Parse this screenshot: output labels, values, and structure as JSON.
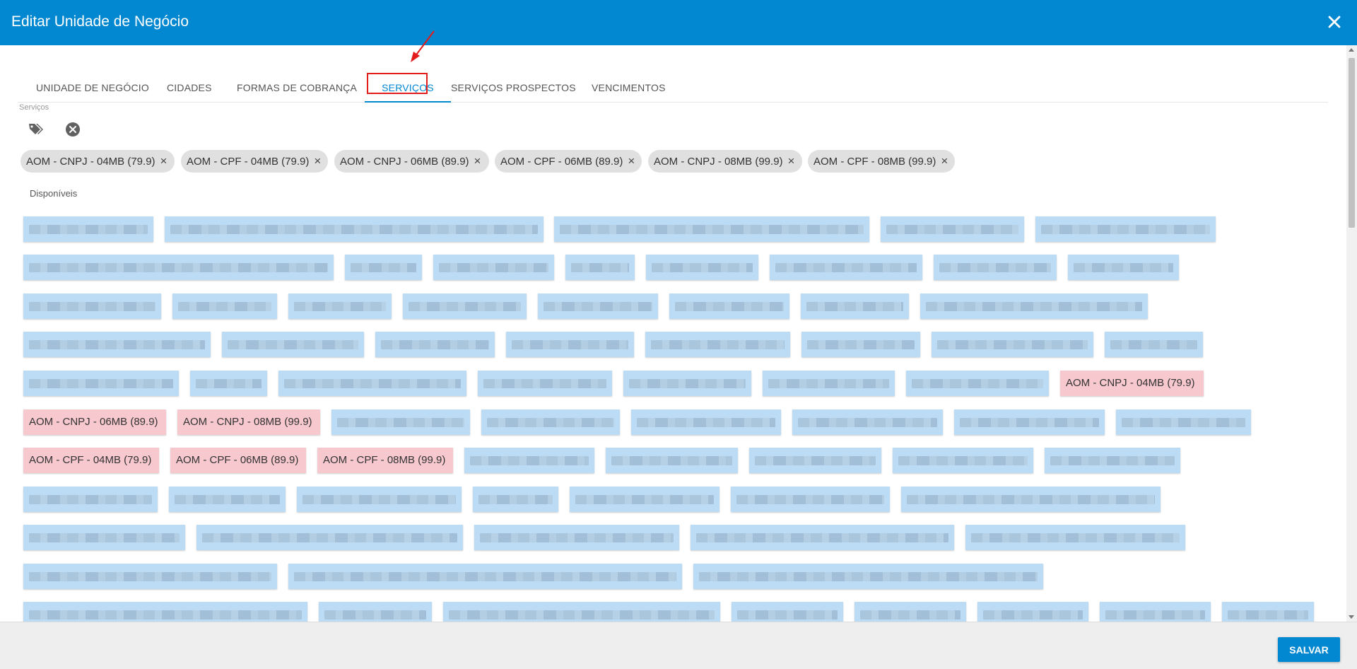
{
  "dialog": {
    "title": "Editar Unidade de Negócio",
    "close_icon": "close-icon"
  },
  "tabs": [
    {
      "label": "Unidade de Negócio",
      "active": false
    },
    {
      "label": "Cidades",
      "active": false
    },
    {
      "label": "Formas de Cobrança",
      "active": false
    },
    {
      "label": "Serviços",
      "active": true
    },
    {
      "label": "Serviços Prospectos",
      "active": false
    },
    {
      "label": "Vencimentos",
      "active": false
    }
  ],
  "annotation": {
    "highlight_color": "#e31b1b"
  },
  "services": {
    "label": "Serviços",
    "selected": [
      "AOM - CNPJ - 04MB (79.9)",
      "AOM - CPF - 04MB (79.9)",
      "AOM - CNPJ - 06MB (89.9)",
      "AOM - CPF - 06MB (89.9)",
      "AOM - CNPJ - 08MB (99.9)",
      "AOM - CPF - 08MB (99.9)"
    ],
    "available_label": "Disponíveis",
    "highlighted": [
      "AOM - CNPJ - 04MB (79.9)",
      "AOM - CNPJ - 06MB (89.9)",
      "AOM - CNPJ - 08MB (99.9)",
      "AOM - CPF - 04MB (79.9)",
      "AOM - CPF - 06MB (89.9)",
      "AOM - CPF - 08MB (99.9)"
    ]
  },
  "footer": {
    "save_label": "Salvar"
  },
  "colors": {
    "primary": "#0288d1",
    "available": "#bcdcf5",
    "selected_available": "#f7c9cf",
    "chip": "#e0e0e0"
  }
}
